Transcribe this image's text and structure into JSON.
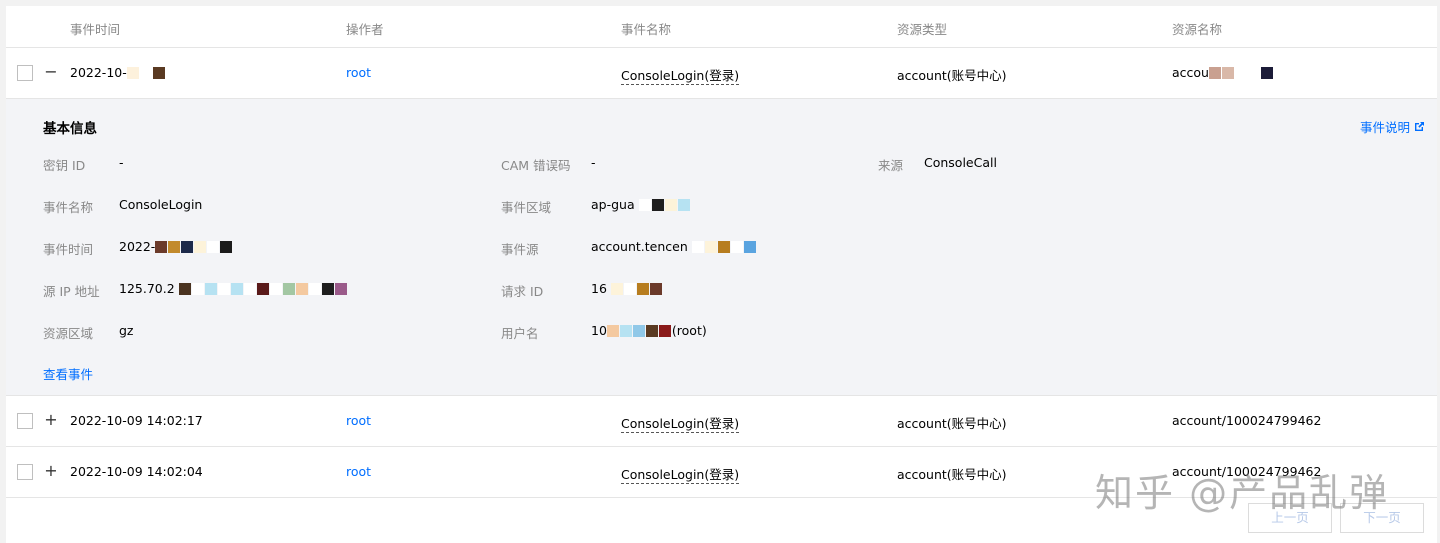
{
  "table": {
    "columns": [
      "事件时间",
      "操作者",
      "事件名称",
      "资源类型",
      "资源名称"
    ],
    "rows": [
      {
        "toggle": "−",
        "time": "2022-10-",
        "operator": "root",
        "event_name": "ConsoleLogin(登录)",
        "resource_type": "account(账号中心)",
        "resource_name": "accou"
      },
      {
        "toggle": "+",
        "time": "2022-10-09 14:02:17",
        "operator": "root",
        "event_name": "ConsoleLogin(登录)",
        "resource_type": "account(账号中心)",
        "resource_name": "account/100024799462"
      },
      {
        "toggle": "+",
        "time": "2022-10-09 14:02:04",
        "operator": "root",
        "event_name": "ConsoleLogin(登录)",
        "resource_type": "account(账号中心)",
        "resource_name": "account/100024799462"
      }
    ]
  },
  "detail": {
    "title": "基本信息",
    "doc_link": "事件说明",
    "fields": {
      "secret_id": {
        "label": "密钥 ID",
        "value": "-"
      },
      "cam_error": {
        "label": "CAM 错误码",
        "value": "-"
      },
      "source": {
        "label": "来源",
        "value": "ConsoleCall"
      },
      "event_name": {
        "label": "事件名称",
        "value": "ConsoleLogin"
      },
      "region": {
        "label": "事件区域",
        "value": "ap-gua"
      },
      "event_time": {
        "label": "事件时间",
        "value": "2022-"
      },
      "event_source": {
        "label": "事件源",
        "value": "account.tencen"
      },
      "source_ip": {
        "label": "源 IP 地址",
        "value": "125.70.2"
      },
      "request_id": {
        "label": "请求 ID",
        "value": "16"
      },
      "resource_region": {
        "label": "资源区域",
        "value": "gz"
      },
      "username": {
        "label": "用户名",
        "value": "10",
        "suffix": "(root)"
      }
    },
    "view_events": "查看事件"
  },
  "pager": {
    "prev": "上一页",
    "next": "下一页"
  },
  "watermark": "知乎 @产品乱弹",
  "colors": {
    "link": "#006eff",
    "detail_bg": "#f3f4f7"
  }
}
